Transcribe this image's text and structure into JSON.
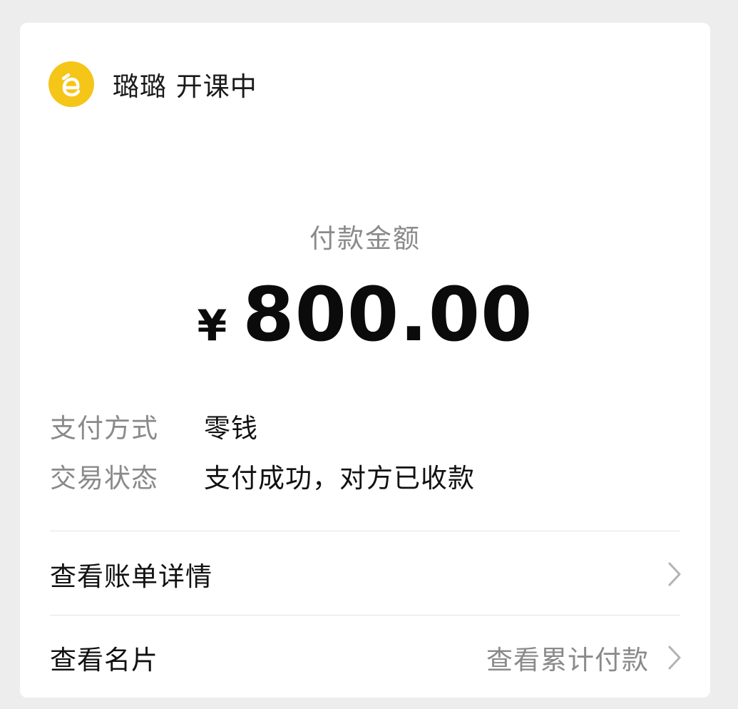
{
  "merchant": {
    "name": "璐璐 开课中",
    "logo_color": "#f5c518",
    "logo_icon": "letter-e-logo"
  },
  "payment": {
    "amount_label": "付款金额",
    "currency": "¥",
    "amount": "800.00"
  },
  "details": [
    {
      "label": "支付方式",
      "value": "零钱"
    },
    {
      "label": "交易状态",
      "value": "支付成功，对方已收款"
    }
  ],
  "actions": {
    "bill_details": {
      "label": "查看账单详情",
      "icon": "chevron-right-icon"
    },
    "business_card": {
      "label": "查看名片",
      "hint": "查看累计付款",
      "icon": "chevron-right-icon"
    }
  }
}
